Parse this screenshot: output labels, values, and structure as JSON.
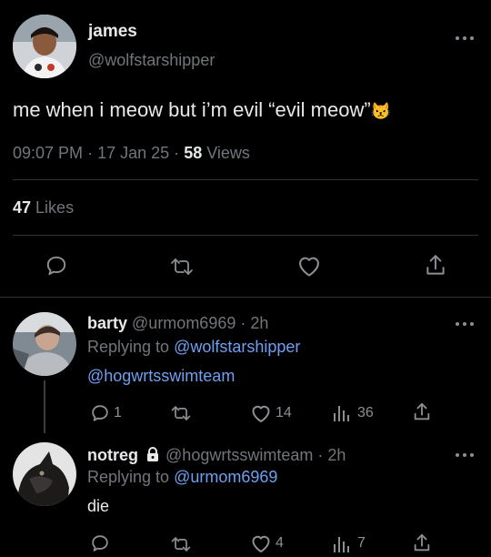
{
  "tweet": {
    "author_name": "james",
    "author_handle": "@wolfstarshipper",
    "text": "me when i meow but i’m evil “evil meow”",
    "emoji": "😾",
    "time": "09:07 PM",
    "date": "17 Jan 25",
    "views_count": "58",
    "views_label": "Views",
    "likes_count": "47",
    "likes_label": "Likes",
    "sep": "·"
  },
  "replies": [
    {
      "name": "barty",
      "handle": "@urmom6969",
      "time": "2h",
      "replying_label": "Replying to",
      "replying_to": "@wolfstarshipper",
      "text": "@hogwrtsswimteam",
      "replies": "1",
      "likes": "14",
      "views": "36"
    },
    {
      "name": "notreg",
      "handle": "@hogwrtsswimteam",
      "time": "2h",
      "replying_label": "Replying to",
      "replying_to": "@urmom6969",
      "text": "die",
      "likes": "4",
      "views": "7"
    }
  ],
  "icons": [
    "more-icon",
    "reply-icon",
    "retweet-icon",
    "like-icon",
    "share-icon",
    "views-icon",
    "lock-icon"
  ],
  "colors": {
    "background": "#000000",
    "text": "#e7e9ea",
    "secondary": "#71767b",
    "link": "#6f9ff0",
    "divider": "#2f3336"
  }
}
